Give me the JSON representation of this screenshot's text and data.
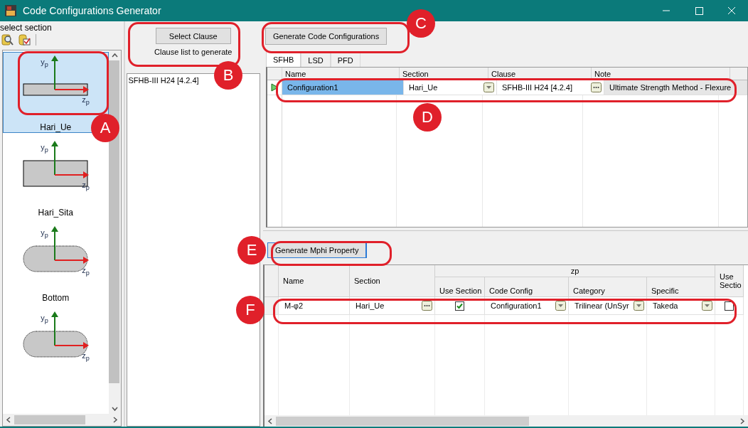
{
  "window": {
    "title": "Code Configurations Generator"
  },
  "section_panel": {
    "label": "select section",
    "items": [
      {
        "name": "Hari_Ue",
        "kind": "thin",
        "selected": true,
        "y_axis": "y$_{p}$",
        "z_axis": "z$_{p}$"
      },
      {
        "name": "Hari_Sita",
        "kind": "rect",
        "selected": false,
        "y_axis": "y$_{p}$",
        "z_axis": "z$_{p}$"
      },
      {
        "name": "Bottom",
        "kind": "rounded",
        "selected": false,
        "y_axis": "y$_{p}$",
        "z_axis": "z$_{p}$"
      },
      {
        "kind": "rounded",
        "selected": false,
        "y_axis": "y$_{p}$",
        "z_axis": "z$_{p}$"
      }
    ]
  },
  "clause_panel": {
    "button": "Select Clause",
    "label": "Clause list to generate",
    "items": [
      "SFHB-III H24 [4.2.4]"
    ]
  },
  "config_panel": {
    "button": "Generate Code Configurations",
    "tabs": [
      {
        "label": "SFHB",
        "selected": true
      },
      {
        "label": "LSD",
        "selected": false
      },
      {
        "label": "PFD",
        "selected": false
      }
    ],
    "columns": [
      {
        "label": "Name"
      },
      {
        "label": "Section",
        "kind": "dropdown"
      },
      {
        "label": "Clause",
        "kind": "ellipsis"
      },
      {
        "label": "Note"
      }
    ],
    "rows": [
      {
        "current": true,
        "cells": [
          "Configuration1",
          "Hari_Ue",
          "SFHB-III H24 [4.2.4]",
          "Ultimate Strength Method - Flexure"
        ]
      }
    ]
  },
  "mphi_panel": {
    "button": "Generate Mphi Property",
    "columns_before": [
      {
        "label": "Name",
        "kind": "text"
      },
      {
        "label": "Section",
        "kind": "ellipsis"
      }
    ],
    "group": {
      "label": "zp",
      "columns": [
        {
          "label": "Use Section",
          "kind": "check"
        },
        {
          "label": "Code Config",
          "kind": "dropdown"
        },
        {
          "label": "Category",
          "kind": "dropdown"
        },
        {
          "label": "Specific",
          "kind": "dropdown"
        }
      ]
    },
    "columns_after": [
      {
        "label": "Use Sectio",
        "kind": "check"
      }
    ],
    "rows": [
      {
        "cells": [
          {
            "text": "M-φ2"
          },
          {
            "text": "Hari_Ue"
          },
          {
            "checked": true
          },
          {
            "text": "Configuration1"
          },
          {
            "text": "Trilinear (UnSyr"
          },
          {
            "text": "Takeda"
          },
          {
            "checked": false
          }
        ]
      }
    ]
  },
  "annotations": [
    {
      "label": "A"
    },
    {
      "label": "B"
    },
    {
      "label": "C"
    },
    {
      "label": "D"
    },
    {
      "label": "E"
    },
    {
      "label": "F"
    }
  ]
}
